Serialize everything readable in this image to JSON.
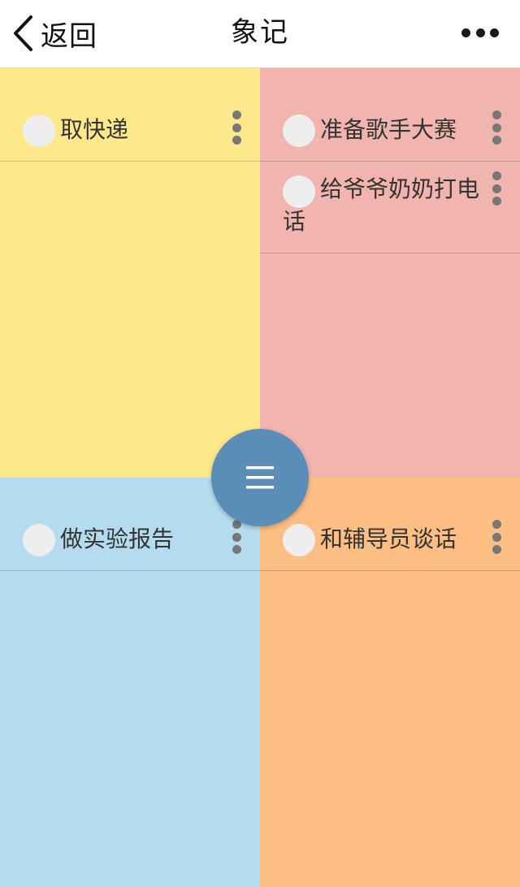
{
  "navbar": {
    "back_label": "返回",
    "title": "象记",
    "more_icon": "more-horizontal-icon"
  },
  "quadrants": {
    "yellow": {
      "color": "#fde88c",
      "items": [
        {
          "label": "取快递"
        }
      ]
    },
    "pink": {
      "color": "#f2b4ae",
      "items": [
        {
          "label": "准备歌手大赛"
        },
        {
          "label": "给爷爷奶奶打电话"
        }
      ]
    },
    "blue": {
      "color": "#b5dcee",
      "items": [
        {
          "label": "做实验报告"
        }
      ]
    },
    "orange": {
      "color": "#fdbe84",
      "items": [
        {
          "label": "和辅导员谈话"
        }
      ]
    }
  },
  "fab": {
    "icon": "menu-icon",
    "color": "#5a8db8"
  }
}
